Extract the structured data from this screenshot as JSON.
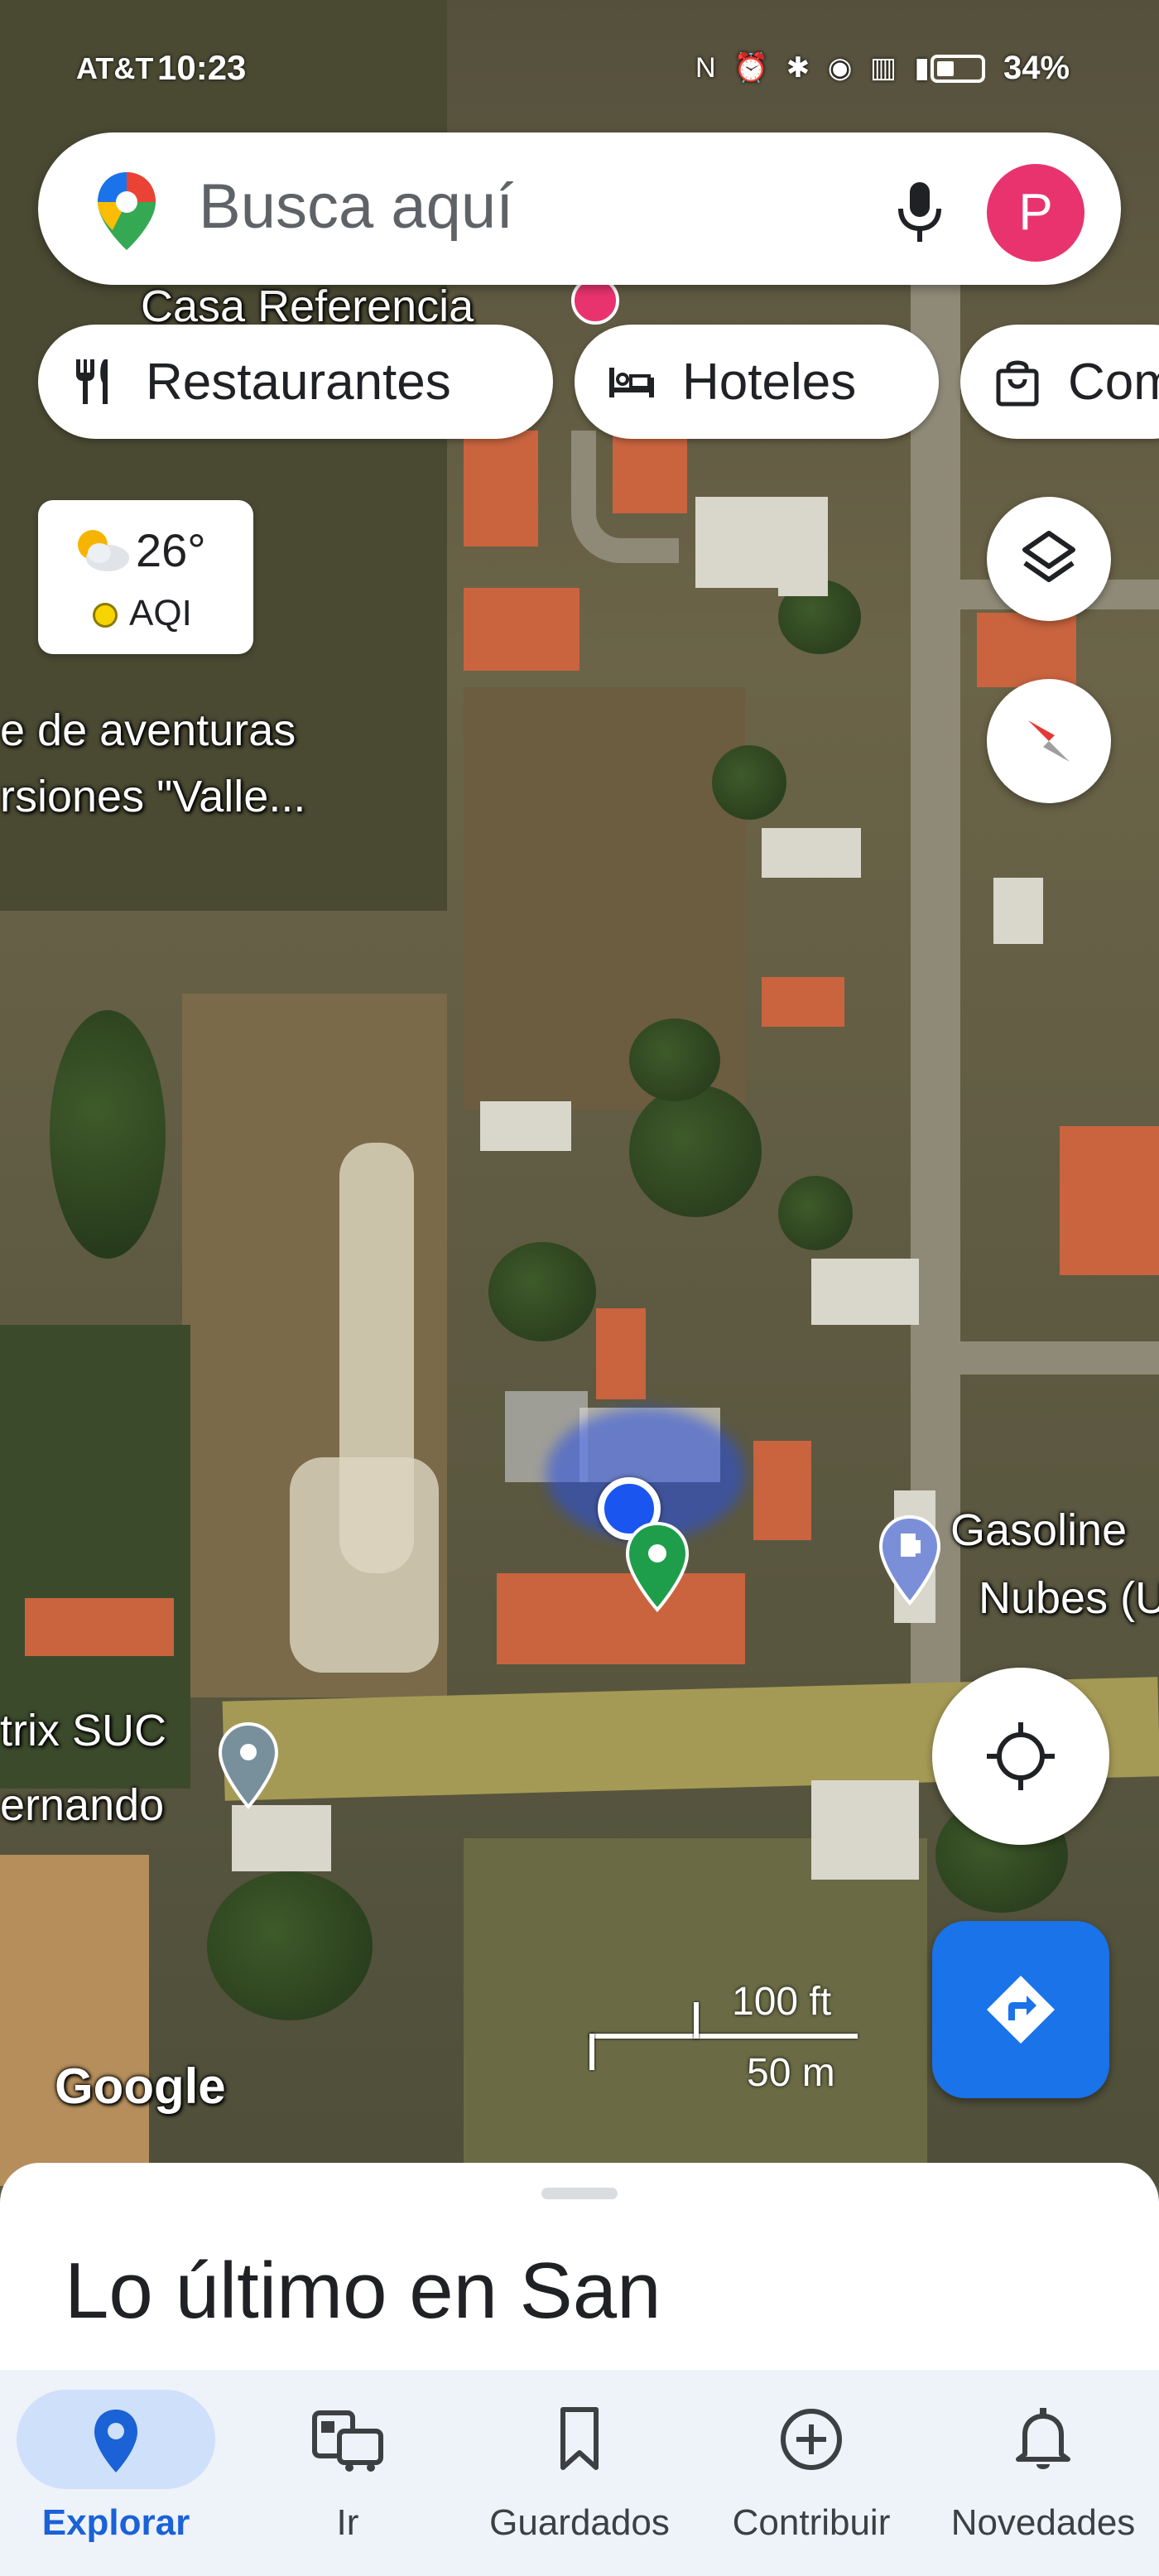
{
  "status_bar": {
    "carrier": "AT&T",
    "time": "10:23",
    "icons": "N ⏰ ✱ ◉ ▥ ▮",
    "battery": "34%"
  },
  "search": {
    "placeholder": "Busca aquí",
    "avatar_letter": "P"
  },
  "chips": [
    {
      "label": "Restaurantes",
      "icon": "fork-knife-icon"
    },
    {
      "label": "Hoteles",
      "icon": "bed-icon"
    },
    {
      "label": "Compras",
      "icon": "shopping-bag-icon"
    }
  ],
  "weather": {
    "temperature": "26°",
    "aqi_label": "AQI",
    "aqi_color": "#f7d300"
  },
  "map_labels": {
    "casa_referencia": "Casa Referencia",
    "aventuras_line1": "e de aventuras",
    "aventuras_line2": "rsiones \"Valle...",
    "gasolinera_line1": "Gasoline",
    "gasolinera_line2": "Nubes (U",
    "trix_line1": "trix SUC",
    "trix_line2": "ernando",
    "google": "Google"
  },
  "scale": {
    "imperial": "100 ft",
    "metric": "50 m"
  },
  "sheet": {
    "title": "Lo último en San"
  },
  "nav": {
    "items": [
      {
        "label": "Explorar",
        "active": true
      },
      {
        "label": "Ir",
        "active": false
      },
      {
        "label": "Guardados",
        "active": false
      },
      {
        "label": "Contribuir",
        "active": false
      },
      {
        "label": "Novedades",
        "active": false
      }
    ]
  },
  "colors": {
    "brand_blue": "#1a73e8",
    "avatar_pink": "#e8336f",
    "active_nav": "#1a62d6"
  }
}
